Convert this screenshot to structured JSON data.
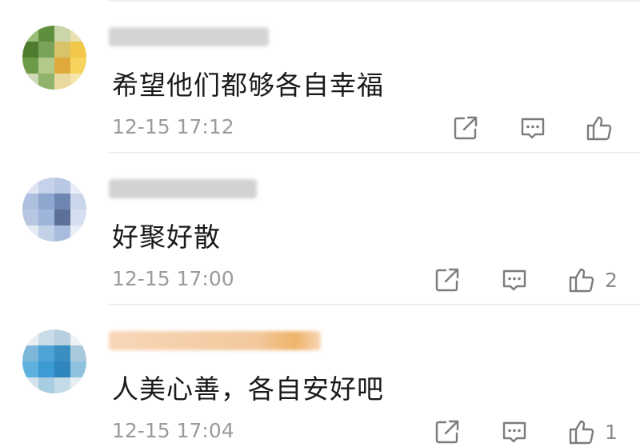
{
  "comments": [
    {
      "text": "希望他们都够各自幸福",
      "time": "12-15 17:12",
      "like_count": "",
      "avatar_colors": [
        "#9bbf7a",
        "#5f8f3e",
        "#c9d6a8",
        "#e8e0b0",
        "#4f7d2f",
        "#7aa35a",
        "#d9c36a",
        "#f2c84b",
        "#6d9a47",
        "#b3c98a",
        "#e0a93b",
        "#f5d35c",
        "#cfd9b8",
        "#8fb36a",
        "#e9d9a0",
        "#f7e4a8"
      ],
      "name_color": "#cfcfcf"
    },
    {
      "text": "好聚好散",
      "time": "12-15 17:00",
      "like_count": "2",
      "avatar_colors": [
        "#dfe6f2",
        "#c5d3ea",
        "#b8c8e4",
        "#e7edf6",
        "#aebfdf",
        "#8fa6cf",
        "#6f86b3",
        "#c9d6ec",
        "#b7c7e3",
        "#9fb4d9",
        "#5c7099",
        "#d4def0",
        "#e4eaf4",
        "#c2d0e8",
        "#a9bcdd",
        "#e9eef7"
      ],
      "name_color": "#cdcdcd"
    },
    {
      "text": "人美心善，各自安好吧",
      "time": "12-15 17:04",
      "like_count": "1",
      "avatar_colors": [
        "#e9eef2",
        "#c9dbe6",
        "#b7cfdf",
        "#eef2f5",
        "#7fb7d9",
        "#4ea3d6",
        "#3a8ec2",
        "#a9c9dd",
        "#5eb0de",
        "#3c9bd2",
        "#2f86bd",
        "#8ec1de",
        "#d5e4ec",
        "#a8cde2",
        "#c4dbe8",
        "#e6eef3"
      ],
      "name_color": "#f7c89a"
    }
  ],
  "icons": {
    "share": "share-icon",
    "reply": "comment-icon",
    "like": "thumbs-up-icon"
  }
}
